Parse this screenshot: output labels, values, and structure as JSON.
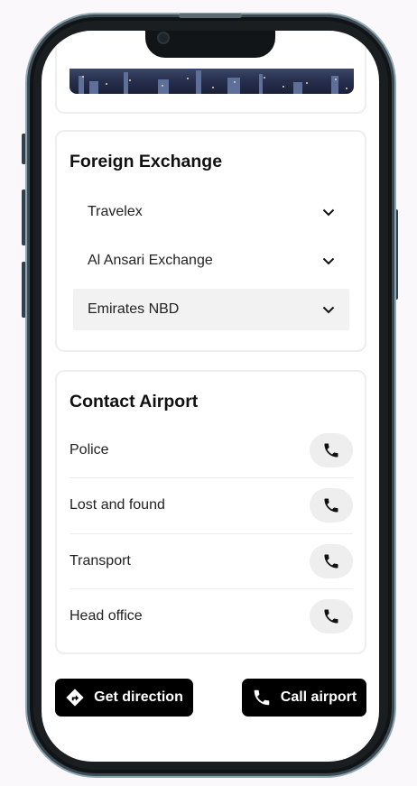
{
  "foreign_exchange": {
    "title": "Foreign Exchange",
    "items": [
      {
        "label": "Travelex",
        "icon": "chevron-down-icon"
      },
      {
        "label": "Al Ansari Exchange",
        "icon": "chevron-down-icon"
      },
      {
        "label": "Emirates NBD",
        "icon": "chevron-down-icon",
        "highlighted": true
      }
    ]
  },
  "contact_airport": {
    "title": "Contact Airport",
    "items": [
      {
        "label": "Police",
        "icon": "phone-icon"
      },
      {
        "label": "Lost and found",
        "icon": "phone-icon"
      },
      {
        "label": "Transport",
        "icon": "phone-icon"
      },
      {
        "label": "Head office",
        "icon": "phone-icon"
      }
    ]
  },
  "actions": {
    "direction_label": "Get direction",
    "call_label": "Call airport"
  },
  "colors": {
    "button_bg": "#000000",
    "button_text": "#ffffff",
    "highlight_row": "#f2f2f2",
    "call_pill": "#eeeeee"
  }
}
